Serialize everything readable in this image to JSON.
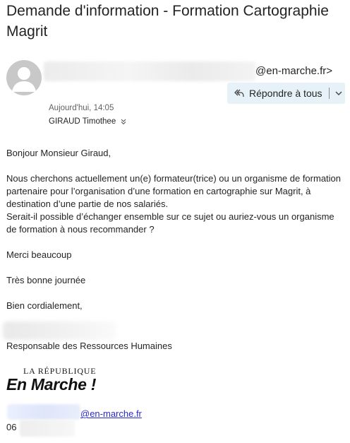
{
  "email": {
    "subject": "Demande d'information - Formation Cartographie Magrit",
    "sender_domain": "@en-marche.fr>",
    "reply_all_label": "Répondre à tous",
    "date": "Aujourd'hui, 14:05",
    "recipient": "GIRAUD Timothee"
  },
  "body": {
    "greeting": "Bonjour Monsieur Giraud,",
    "paragraph1": "Nous cherchons actuellement un(e) formateur(trice) ou un organisme de formation partenaire pour l’organisation d’une formation en cartographie sur Magrit, à destination d’une partie de nos salariés.",
    "paragraph2": "Serait-il possible d’échanger ensemble sur ce sujet ou auriez-vous un organisme de formation à nous recommander ?",
    "thanks": "Merci beaucoup",
    "wish": "Très bonne journée",
    "closing": "Bien cordialement,"
  },
  "signature": {
    "title": "Responsable des Ressources Humaines",
    "logo_top": "LA RÉPUBLIQUE",
    "logo_main": "En Marche !",
    "email_domain": "@en-marche.fr",
    "phone_prefix": "06"
  },
  "colors": {
    "reply_button_bg": "#e6f2f8",
    "link": "#2a2ad0",
    "avatar": "#c8c8c8"
  }
}
